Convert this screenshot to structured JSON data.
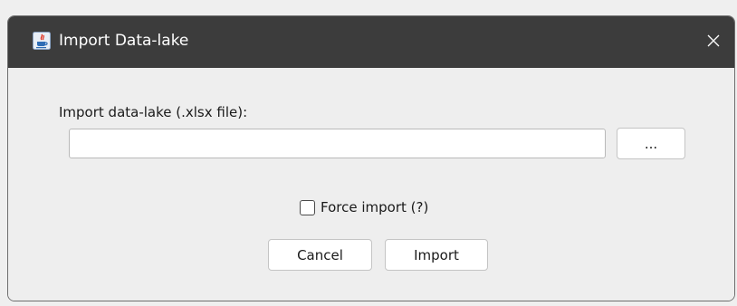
{
  "dialog": {
    "title": "Import Data-lake",
    "app_icon": "java-icon",
    "close_icon": "close-icon"
  },
  "form": {
    "field_label": "Import data-lake (.xlsx file):",
    "file_path_value": "",
    "browse_label": "...",
    "force_import_label": "Force import (?)",
    "force_import_checked": false
  },
  "actions": {
    "cancel_label": "Cancel",
    "import_label": "Import"
  },
  "colors": {
    "titlebar": "#3c3c3c",
    "dialog_bg": "#eeeeee",
    "button_bg": "#ffffff"
  }
}
